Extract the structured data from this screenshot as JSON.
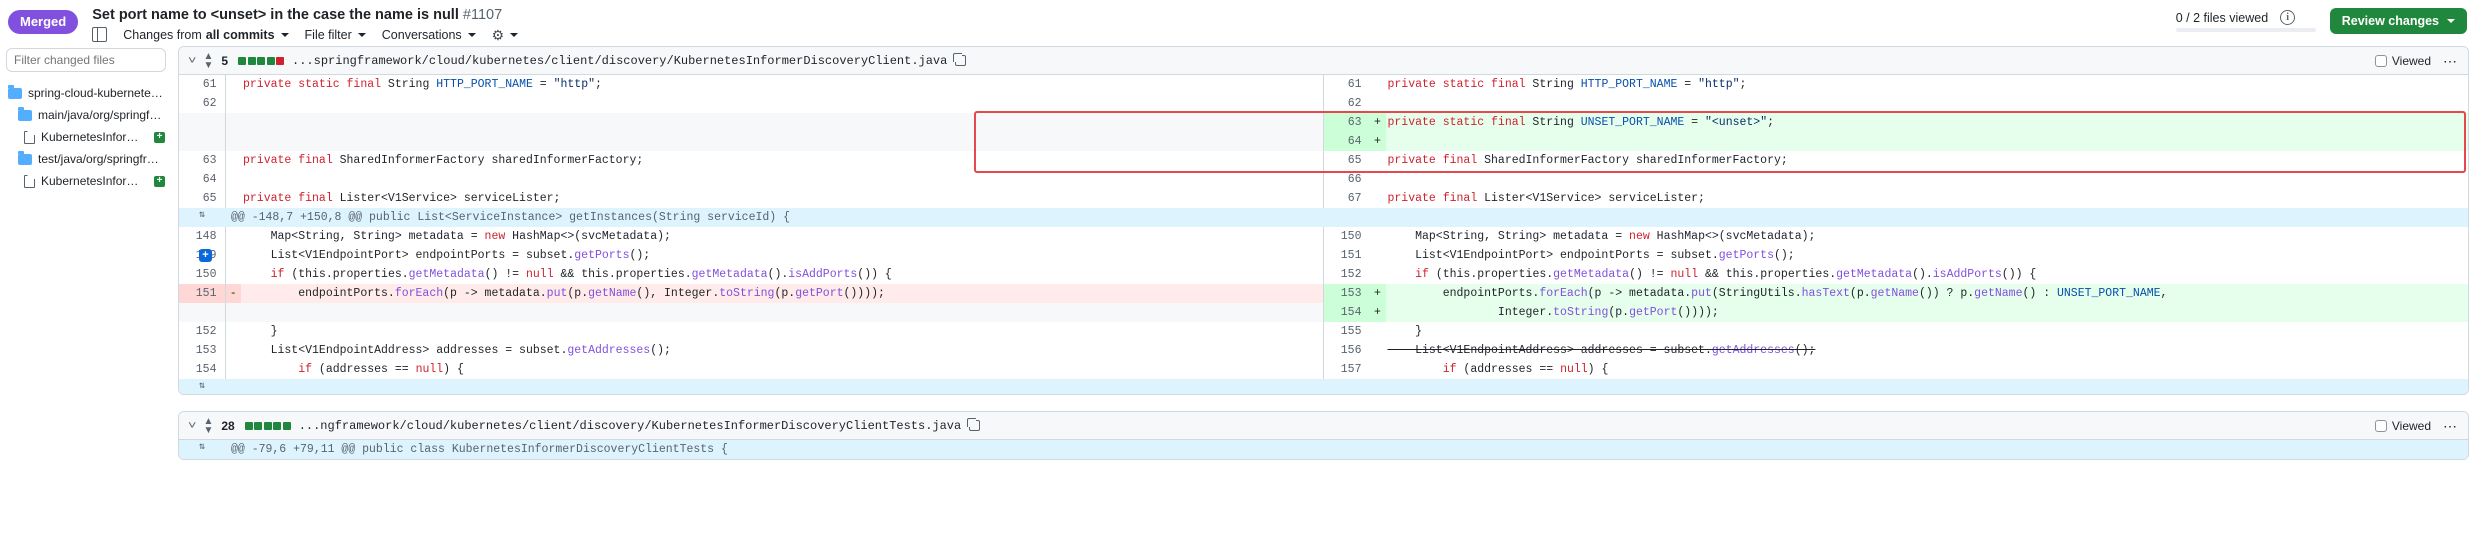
{
  "header": {
    "status_badge": "Merged",
    "title": "Set port name to <unset> in the case the name is null",
    "pr_number": "#1107",
    "sidebar_toggle_icon": "sidebar-toggle-icon",
    "changes_label_prefix": "Changes from",
    "changes_label_value": "all commits",
    "file_filter_label": "File filter",
    "conversations_label": "Conversations",
    "gear_icon": "gear-icon",
    "files_viewed": "0 / 2 files viewed",
    "info_icon": "i",
    "review_button": "Review changes"
  },
  "sidebar": {
    "filter_placeholder": "Filter changed files",
    "tree": [
      {
        "type": "folder",
        "level": 1,
        "label": "spring-cloud-kubernetes-client-d...",
        "badge": null
      },
      {
        "type": "folder",
        "level": 2,
        "label": "main/java/org/springframework/c...",
        "badge": null
      },
      {
        "type": "file",
        "level": 3,
        "label": "KubernetesInformerDiscove...",
        "badge": "+"
      },
      {
        "type": "folder",
        "level": 2,
        "label": "test/java/org/springframework/cl...",
        "badge": null
      },
      {
        "type": "file",
        "level": 3,
        "label": "KubernetesInformerDiscove...",
        "badge": "+"
      }
    ]
  },
  "files": [
    {
      "diffstat_count": "5",
      "diffstat_blocks": [
        "g",
        "g",
        "g",
        "g",
        "r"
      ],
      "path": "...springframework/cloud/kubernetes/client/discovery/KubernetesInformerDiscoveryClient.java",
      "copy_icon": "copy-icon",
      "viewed_label": "Viewed",
      "kebab": "⋯",
      "rows": [
        {
          "kind": "ctx",
          "lnL": "61",
          "sgL": "",
          "codeL": "    private static final String HTTP_PORT_NAME = \"http\";",
          "lnR": "61",
          "sgR": "",
          "codeR": "    private static final String HTTP_PORT_NAME = \"http\";"
        },
        {
          "kind": "ctx",
          "lnL": "62",
          "sgL": "",
          "codeL": "",
          "lnR": "62",
          "sgR": "",
          "codeR": ""
        },
        {
          "kind": "addR",
          "lnL": "",
          "sgL": "",
          "codeL": "",
          "lnR": "63",
          "sgR": "+",
          "codeR": "    private static final String UNSET_PORT_NAME = \"<unset>\";"
        },
        {
          "kind": "addR",
          "lnL": "",
          "sgL": "",
          "codeL": "",
          "lnR": "64",
          "sgR": "+",
          "codeR": ""
        },
        {
          "kind": "ctx",
          "lnL": "63",
          "sgL": "",
          "codeL": "    private final SharedInformerFactory sharedInformerFactory;",
          "lnR": "65",
          "sgR": "",
          "codeR": "    private final SharedInformerFactory sharedInformerFactory;"
        },
        {
          "kind": "ctx",
          "lnL": "64",
          "sgL": "",
          "codeL": "",
          "lnR": "66",
          "sgR": "",
          "codeR": ""
        },
        {
          "kind": "ctx",
          "lnL": "65",
          "sgL": "",
          "codeL": "    private final Lister<V1Service> serviceLister;",
          "lnR": "67",
          "sgR": "",
          "codeR": "    private final Lister<V1Service> serviceLister;"
        }
      ],
      "hunk_header": "@@ -148,7 +150,8 @@ public List<ServiceInstance> getInstances(String serviceId) {",
      "rows2": [
        {
          "kind": "ctx",
          "lnL": "148",
          "sgL": "",
          "codeL": "        Map<String, String> metadata = new HashMap<>(svcMetadata);",
          "lnR": "150",
          "sgR": "",
          "codeR": "        Map<String, String> metadata = new HashMap<>(svcMetadata);"
        },
        {
          "kind": "ctx",
          "lnL": "149",
          "sgL": "",
          "marker": "+",
          "codeL": "        List<V1EndpointPort> endpointPorts = subset.getPorts();",
          "lnR": "151",
          "sgR": "",
          "codeR": "        List<V1EndpointPort> endpointPorts = subset.getPorts();"
        },
        {
          "kind": "ctx",
          "lnL": "150",
          "sgL": "",
          "codeL": "        if (this.properties.getMetadata() != null && this.properties.getMetadata().isAddPorts()) {",
          "lnR": "152",
          "sgR": "",
          "codeR": "        if (this.properties.getMetadata() != null && this.properties.getMetadata().isAddPorts()) {"
        },
        {
          "kind": "delL",
          "lnL": "151",
          "sgL": "-",
          "codeL": "            endpointPorts.forEach(p -> metadata.put(p.getName(), Integer.toString(p.getPort())));",
          "lnR": "153",
          "sgR": "+",
          "codeR": "            endpointPorts.forEach(p -> metadata.put(StringUtils.hasText(p.getName()) ? p.getName() : UNSET_PORT_NAME,"
        },
        {
          "kind": "addR2",
          "lnL": "",
          "sgL": "",
          "codeL": "",
          "lnR": "154",
          "sgR": "+",
          "codeR": "                    Integer.toString(p.getPort())));"
        },
        {
          "kind": "ctx",
          "lnL": "152",
          "sgL": "",
          "codeL": "        }",
          "lnR": "155",
          "sgR": "",
          "codeR": "        }"
        },
        {
          "kind": "ctx",
          "lnL": "153",
          "sgL": "",
          "codeL": "        List<V1EndpointAddress> addresses = subset.getAddresses();",
          "lnR": "156",
          "sgR": "",
          "codeR": "        List<V1EndpointAddress> addresses = subset.getAddresses();",
          "strikeR": true
        },
        {
          "kind": "ctx",
          "lnL": "154",
          "sgL": "",
          "codeL": "        if (addresses == null) {",
          "lnR": "157",
          "sgR": "",
          "codeR": "        if (addresses == null) {"
        }
      ]
    },
    {
      "diffstat_count": "28",
      "diffstat_blocks": [
        "g",
        "g",
        "g",
        "g",
        "g"
      ],
      "path": "...ngframework/cloud/kubernetes/client/discovery/KubernetesInformerDiscoveryClientTests.java",
      "copy_icon": "copy-icon",
      "viewed_label": "Viewed",
      "kebab": "⋯",
      "hunk_header": "@@ -79,6 +79,11 @@ public class KubernetesInformerDiscoveryClientTests {"
    }
  ]
}
